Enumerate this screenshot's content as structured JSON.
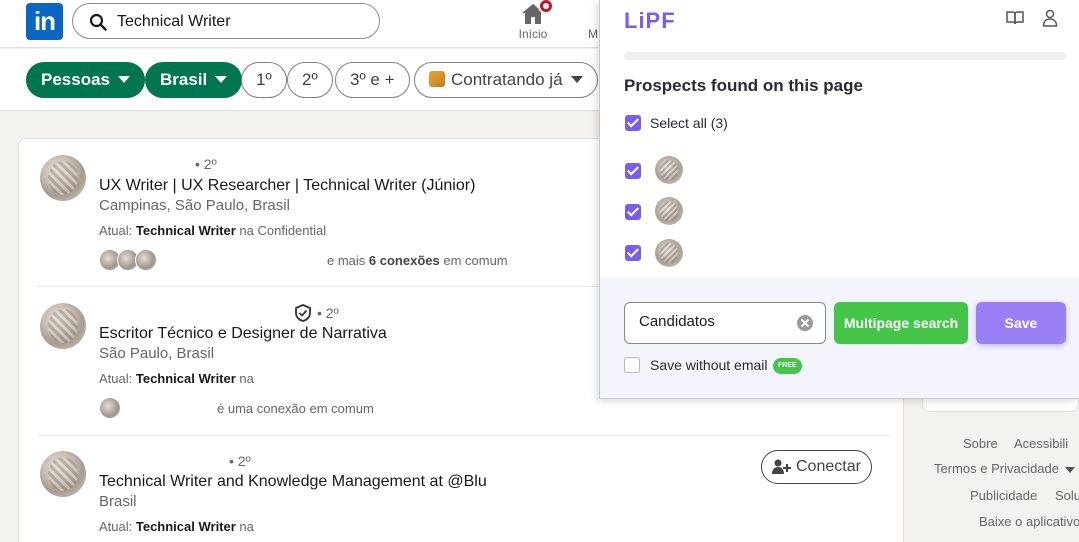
{
  "topnav": {
    "logo_text": "in",
    "search_value": "Technical Writer",
    "home_label": "Início",
    "next_label": "M"
  },
  "filters": {
    "people": "Pessoas",
    "country": "Brasil",
    "deg1": "1º",
    "deg2": "2º",
    "deg3": "3º e +",
    "hiring": "Contratando já"
  },
  "results": [
    {
      "degree": "• 2º",
      "title": "UX Writer | UX Researcher | Technical Writer (Júnior)",
      "location": "Campinas, São Paulo, Brasil",
      "current_prefix": "Atual: ",
      "current_bold": "Technical Writer",
      "current_suffix": " na Confidential",
      "connections_prefix": "e mais ",
      "connections_bold": "6 conexões",
      "connections_suffix": " em comum"
    },
    {
      "degree": "• 2º",
      "title": "Escritor Técnico e Designer de Narrativa",
      "location": "São Paulo, Brasil",
      "current_prefix": "Atual: ",
      "current_bold": "Technical Writer",
      "current_suffix": " na",
      "connections_text": "é uma conexão em comum"
    },
    {
      "degree": "• 2º",
      "title": "Technical Writer and Knowledge Management at @Blu",
      "location": "Brasil",
      "current_prefix": "Atual: ",
      "current_bold": "Technical Writer",
      "current_suffix": " na",
      "action": "Conectar"
    }
  ],
  "footer": {
    "about": "Sobre",
    "accessibility": "Acessibili",
    "terms": "Termos e Privacidade",
    "ads": "Publicidade",
    "solutions": "Solu",
    "app": "Baixe o aplicativo"
  },
  "lipf": {
    "logo": "LiPF",
    "heading": "Prospects found on this page",
    "select_all": "Select all (3)",
    "prospects_checked": [
      true,
      true,
      true
    ],
    "list_value": "Candidatos",
    "multipage_label": "Multipage search",
    "save_label": "Save",
    "save_without_email": "Save without email",
    "free_badge": "FREE",
    "accent_color": "#7b5cf0",
    "green_color": "#44c54a"
  }
}
